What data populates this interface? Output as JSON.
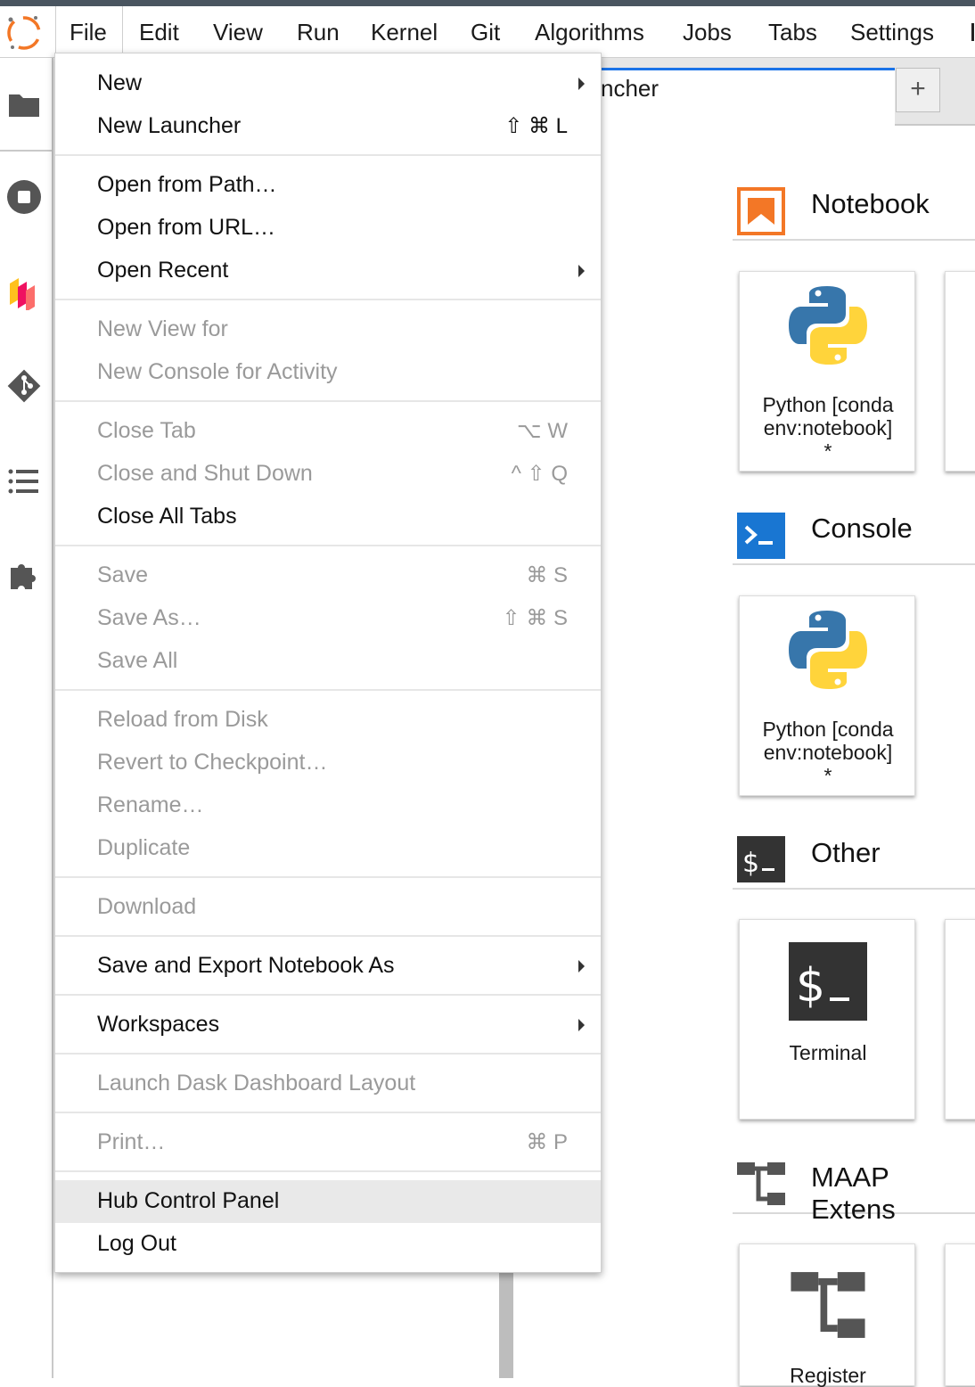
{
  "menubar": {
    "items": [
      "File",
      "Edit",
      "View",
      "Run",
      "Kernel",
      "Git",
      "Algorithms",
      "Jobs",
      "Tabs",
      "Settings"
    ],
    "active": "File"
  },
  "tab": {
    "label": "ncher",
    "add_label": "+"
  },
  "file_menu": {
    "groups": [
      [
        {
          "label": "New",
          "enabled": true,
          "submenu": true
        },
        {
          "label": "New Launcher",
          "enabled": true,
          "shortcut": "⇧ ⌘ L"
        }
      ],
      [
        {
          "label": "Open from Path…",
          "enabled": true
        },
        {
          "label": "Open from URL…",
          "enabled": true
        },
        {
          "label": "Open Recent",
          "enabled": true,
          "submenu": true
        }
      ],
      [
        {
          "label": "New View for",
          "enabled": false
        },
        {
          "label": "New Console for Activity",
          "enabled": false
        }
      ],
      [
        {
          "label": "Close Tab",
          "enabled": false,
          "shortcut": "⌥ W"
        },
        {
          "label": "Close and Shut Down",
          "enabled": false,
          "shortcut": "^ ⇧ Q"
        },
        {
          "label": "Close All Tabs",
          "enabled": true
        }
      ],
      [
        {
          "label": "Save",
          "enabled": false,
          "shortcut": "⌘ S"
        },
        {
          "label": "Save As…",
          "enabled": false,
          "shortcut": "⇧ ⌘ S"
        },
        {
          "label": "Save All",
          "enabled": false
        }
      ],
      [
        {
          "label": "Reload from Disk",
          "enabled": false
        },
        {
          "label": "Revert to Checkpoint…",
          "enabled": false
        },
        {
          "label": "Rename…",
          "enabled": false
        },
        {
          "label": "Duplicate",
          "enabled": false
        }
      ],
      [
        {
          "label": "Download",
          "enabled": false
        }
      ],
      [
        {
          "label": "Save and Export Notebook As",
          "enabled": true,
          "submenu": true
        }
      ],
      [
        {
          "label": "Workspaces",
          "enabled": true,
          "submenu": true
        }
      ],
      [
        {
          "label": "Launch Dask Dashboard Layout",
          "enabled": false
        }
      ],
      [
        {
          "label": "Print…",
          "enabled": false,
          "shortcut": "⌘ P"
        }
      ],
      [
        {
          "label": "Hub Control Panel",
          "enabled": true,
          "highlighted": true
        },
        {
          "label": "Log Out",
          "enabled": true
        }
      ]
    ]
  },
  "launcher": {
    "sections": [
      {
        "title": "Notebook",
        "icon": "notebook-icon",
        "cards": [
          {
            "label_line1": "Python [conda",
            "label_line2": "env:notebook]",
            "label_line3": "*",
            "icon": "python-logo"
          }
        ]
      },
      {
        "title": "Console",
        "icon": "console-icon",
        "cards": [
          {
            "label_line1": "Python [conda",
            "label_line2": "env:notebook]",
            "label_line3": "*",
            "icon": "python-logo"
          }
        ]
      },
      {
        "title": "Other",
        "icon": "terminal-icon",
        "cards": [
          {
            "label_line1": "Terminal",
            "icon": "terminal-icon"
          }
        ]
      },
      {
        "title": "MAAP Extens",
        "icon": "maap-extension-icon",
        "cards": [
          {
            "label_line1": "Register",
            "icon": "maap-extension-icon"
          }
        ]
      }
    ]
  },
  "colors": {
    "accent": "#1a73e8",
    "notebook_orange": "#f37726",
    "console_blue": "#1976d2",
    "terminal_dark": "#333333",
    "python_blue": "#3776ab",
    "python_yellow": "#ffd43b"
  }
}
